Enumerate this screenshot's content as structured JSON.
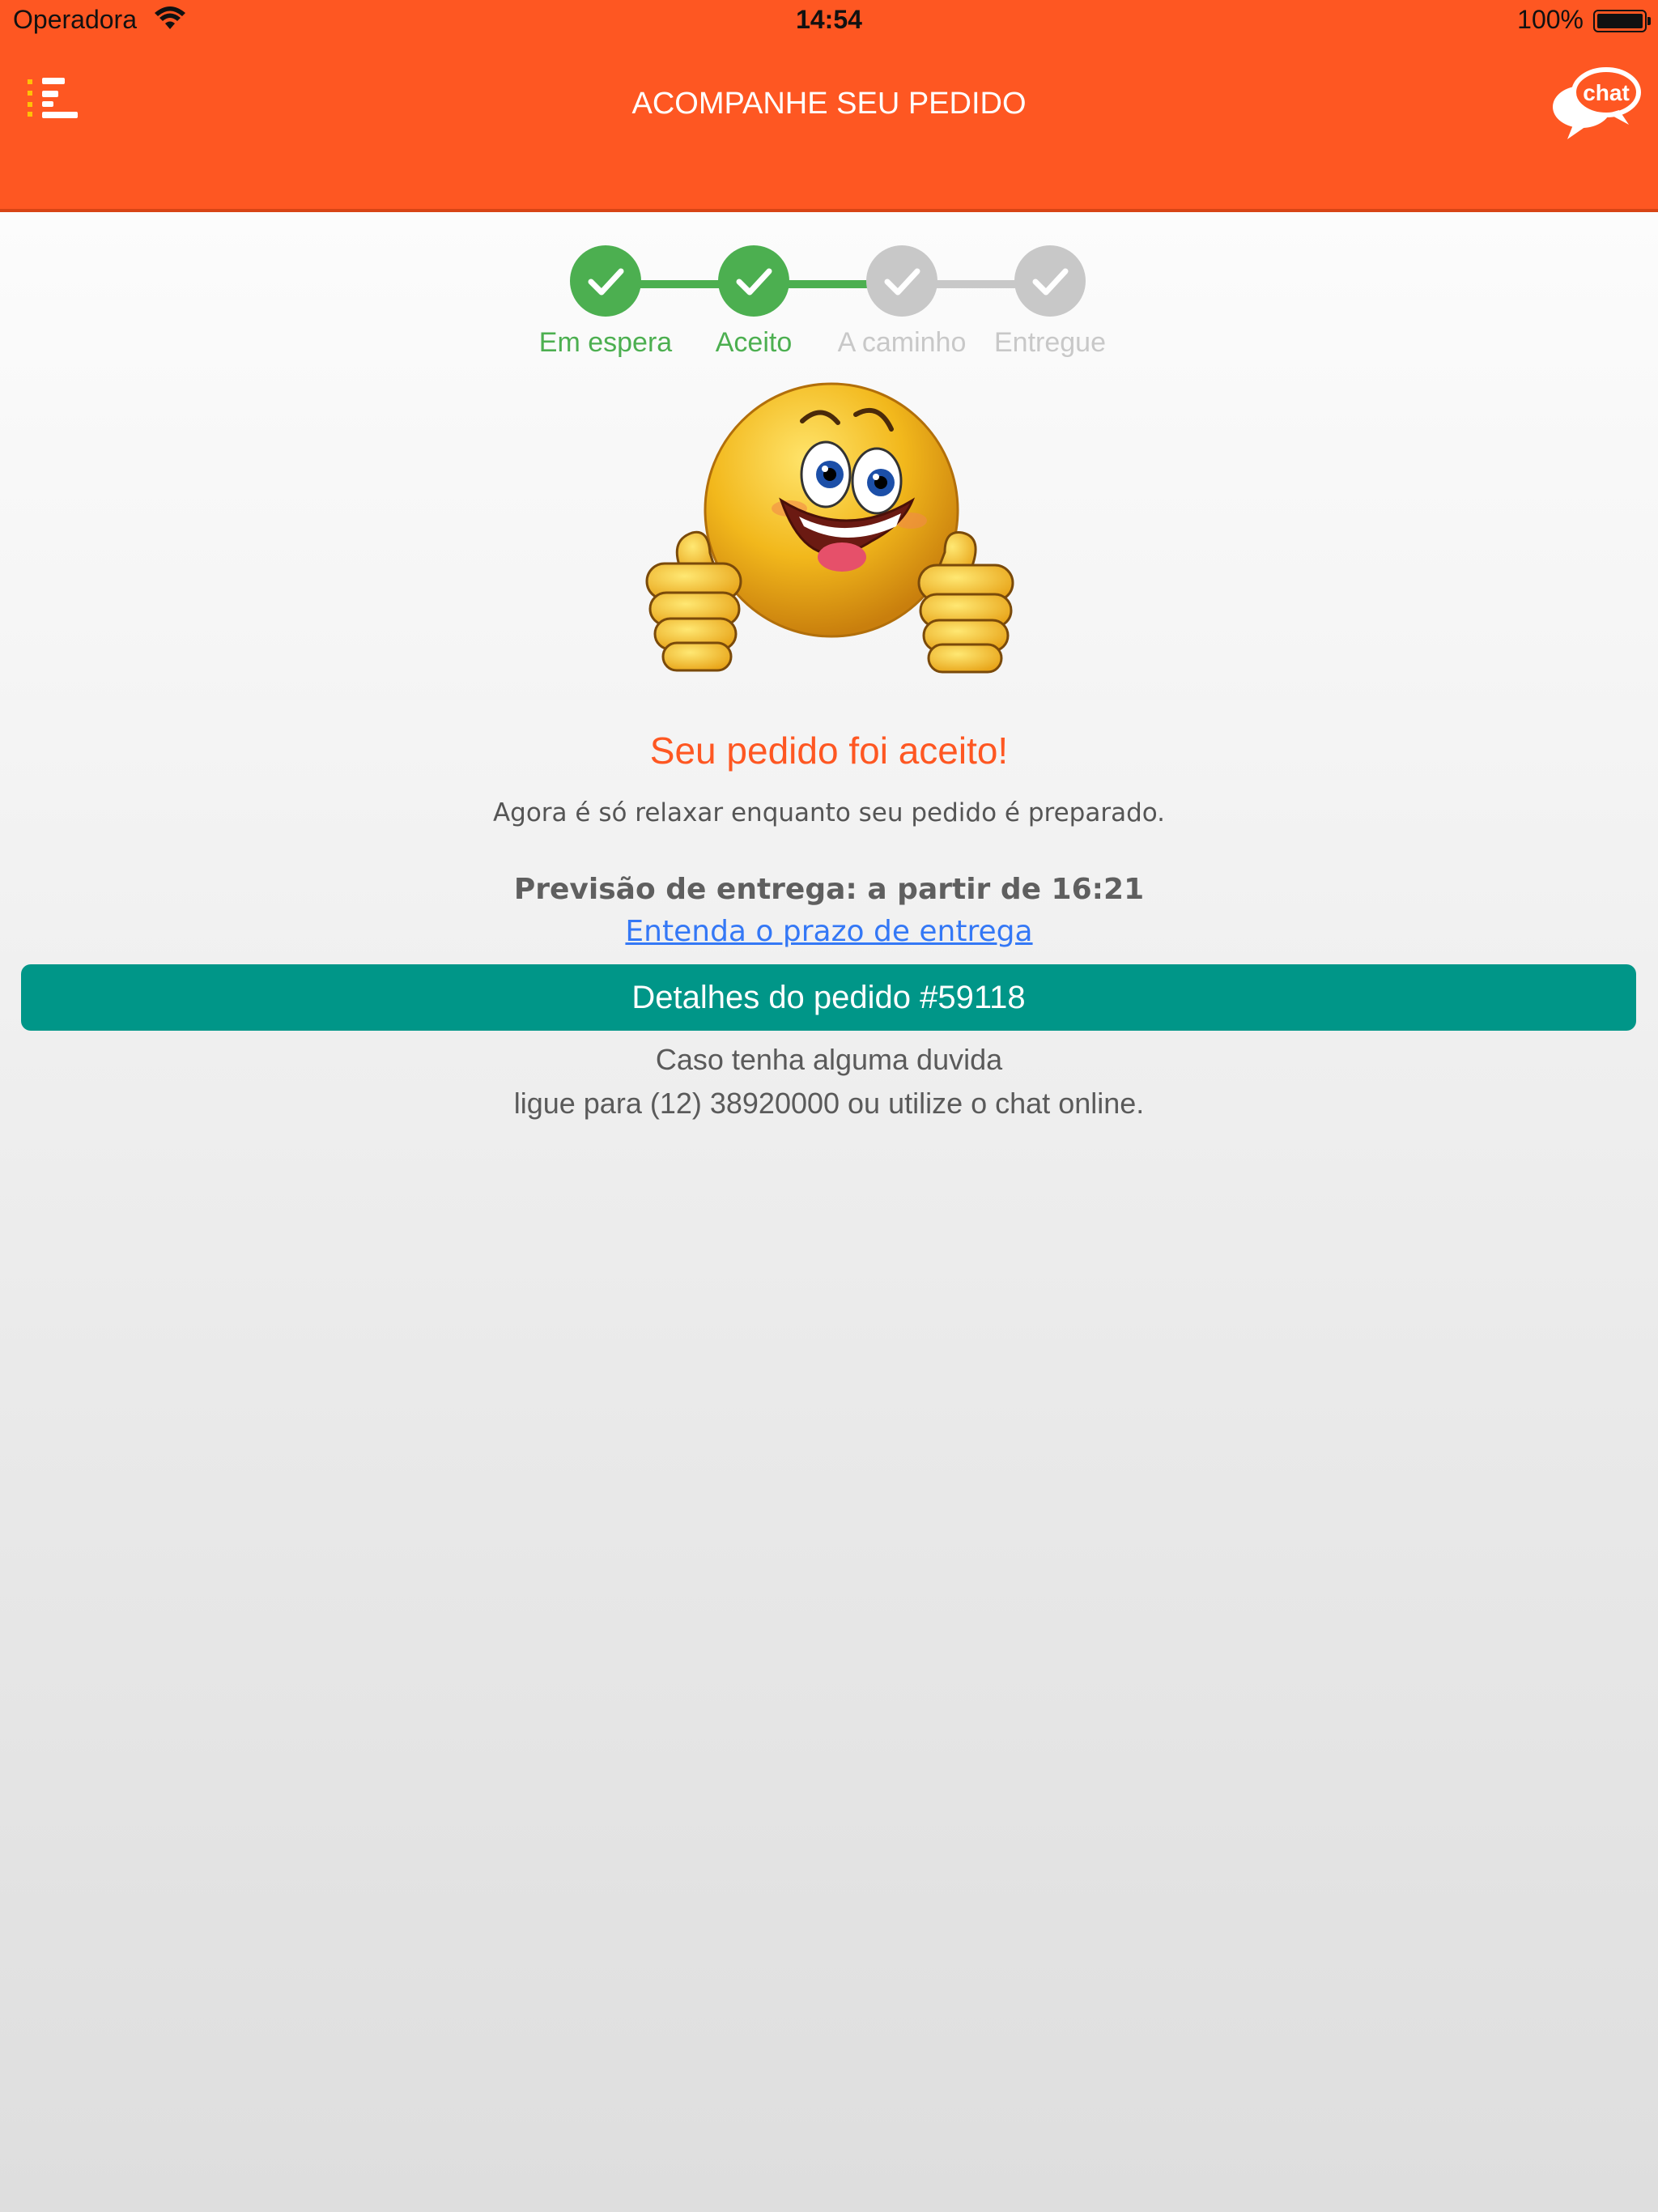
{
  "status_bar": {
    "carrier": "Operadora",
    "time": "14:54",
    "battery": "100%"
  },
  "header": {
    "title": "ACOMPANHE SEU PEDIDO",
    "chat_icon_text": "chat"
  },
  "steps": [
    {
      "label": "Em espera",
      "done": true
    },
    {
      "label": "Aceito",
      "done": true
    },
    {
      "label": "A caminho",
      "done": false
    },
    {
      "label": "Entregue",
      "done": false
    }
  ],
  "colors": {
    "accent": "#fe5722",
    "done": "#4caf50",
    "pending": "#c8c8c8",
    "button": "#009688",
    "link": "#3478f6"
  },
  "main": {
    "headline": "Seu pedido foi aceito!",
    "subtitle": "Agora é só relaxar enquanto seu pedido é preparado.",
    "forecast": "Previsão de entrega: a partir de 16:21",
    "link": "Entenda o prazo de entrega",
    "details_button": "Detalhes do pedido #59118",
    "help_line1": "Caso tenha alguma duvida",
    "help_line2": "ligue para (12) 38920000 ou utilize o chat online."
  }
}
